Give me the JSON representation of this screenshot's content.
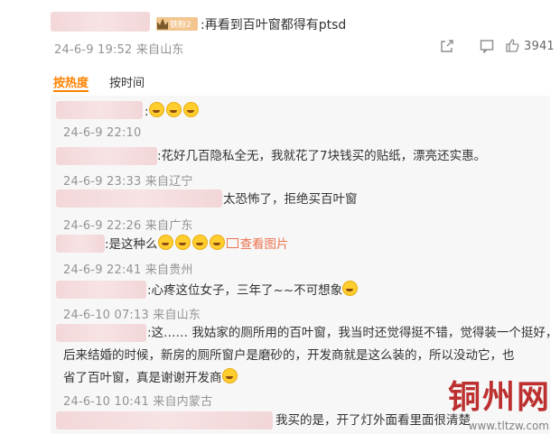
{
  "root_comment": {
    "badge": "铁粉2",
    "text": ":再看到百叶窗都得有ptsd",
    "date_source": "24-6-9 19:52 来自山东",
    "like_count": "3941"
  },
  "tabs": {
    "hot": "按热度",
    "time": "按时间"
  },
  "replies": [
    {
      "text": ":",
      "meta": "24-6-9 22:10"
    },
    {
      "text": ":花好几百隐私全无，我就花了7块钱买的贴纸，漂亮还实惠。",
      "meta": "24-6-9 23:33 来自辽宁"
    },
    {
      "text": "太恐怖了，拒绝买百叶窗",
      "meta": "24-6-9 22:26 来自广东"
    },
    {
      "text": ":是这种么",
      "image_label": "查看图片",
      "meta": "24-6-9 22:41 来自贵州"
    },
    {
      "text": ":心疼这位女子，三年了~~不可想象",
      "meta": "24-6-10 07:13 来自山东"
    },
    {
      "line1": ":这…… 我姑家的厕所用的百叶窗，我当时还觉得挺不错，觉得装一个挺好，",
      "line2": "后来结婚的时候，新房的厕所窗户是磨砂的，开发商就是这么装的，所以没动它，也",
      "line3": "省了百叶窗，真是谢谢开发商",
      "meta": "24-6-10 10:41 来自内蒙古"
    },
    {
      "text": "我买的是，开了灯外面看里面很清楚"
    }
  ],
  "watermark": {
    "text": "铜州网",
    "url": "www.tltzw.com"
  }
}
